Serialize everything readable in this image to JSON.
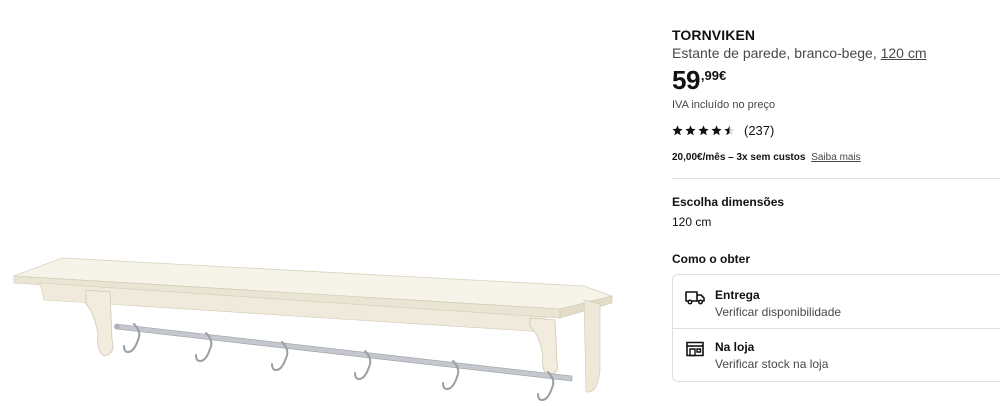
{
  "product": {
    "name": "TORNVIKEN",
    "description": "Estante de parede, branco-bege, ",
    "size_link": "120 cm",
    "price_integer": "59",
    "price_decimal": ",99€",
    "vat_note": "IVA incluído no preço",
    "rating_value": 4.5,
    "rating_count": "(237)",
    "instalment_text": "20,00€/mês – 3x sem custos",
    "instalment_link": "Saiba mais"
  },
  "dimensions": {
    "heading": "Escolha dimensões",
    "selected": "120 cm"
  },
  "obtain": {
    "heading": "Como o obter",
    "options": [
      {
        "icon": "delivery-truck-icon",
        "title": "Entrega",
        "subtitle": "Verificar disponibilidade"
      },
      {
        "icon": "store-icon",
        "title": "Na loja",
        "subtitle": "Verificar stock na loja"
      }
    ]
  },
  "colors": {
    "shelf": "#f4f0e2",
    "rail": "#b9bdc2",
    "text": "#111111",
    "muted": "#484848",
    "border": "#dfdfdf"
  }
}
